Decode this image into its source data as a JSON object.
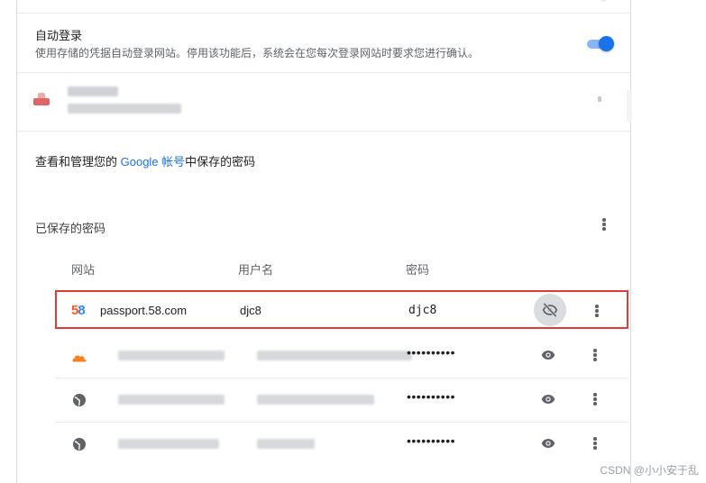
{
  "autologin": {
    "title": "自动登录",
    "description": "使用存储的凭据自动登录网站。停用该功能后，系统会在您每次登录网站时要求您进行确认。",
    "enabled": true
  },
  "manage": {
    "prefix": "查看和管理您的 ",
    "link": "Google 帐号",
    "suffix": "中保存的密码"
  },
  "saved_passwords": {
    "title": "已保存的密码",
    "columns": [
      "网站",
      "用户名",
      "密码"
    ],
    "rows": [
      {
        "site": "passport.58.com",
        "username": "djc8",
        "password": "djc8",
        "revealed": true,
        "icon": "58-logo-icon"
      },
      {
        "site": "",
        "username": "",
        "password": "••••••••••",
        "revealed": false,
        "icon": "cloud-icon"
      },
      {
        "site": "",
        "username": "",
        "password": "••••••••••",
        "revealed": false,
        "icon": "globe-icon"
      },
      {
        "site": "",
        "username": "",
        "password": "••••••••••",
        "revealed": false,
        "icon": "globe-icon"
      }
    ]
  },
  "watermark": "CSDN @小小安于乱",
  "colors": {
    "accent": "#1a73e8",
    "highlight": "#e53935",
    "cloud": "#f6821f"
  }
}
